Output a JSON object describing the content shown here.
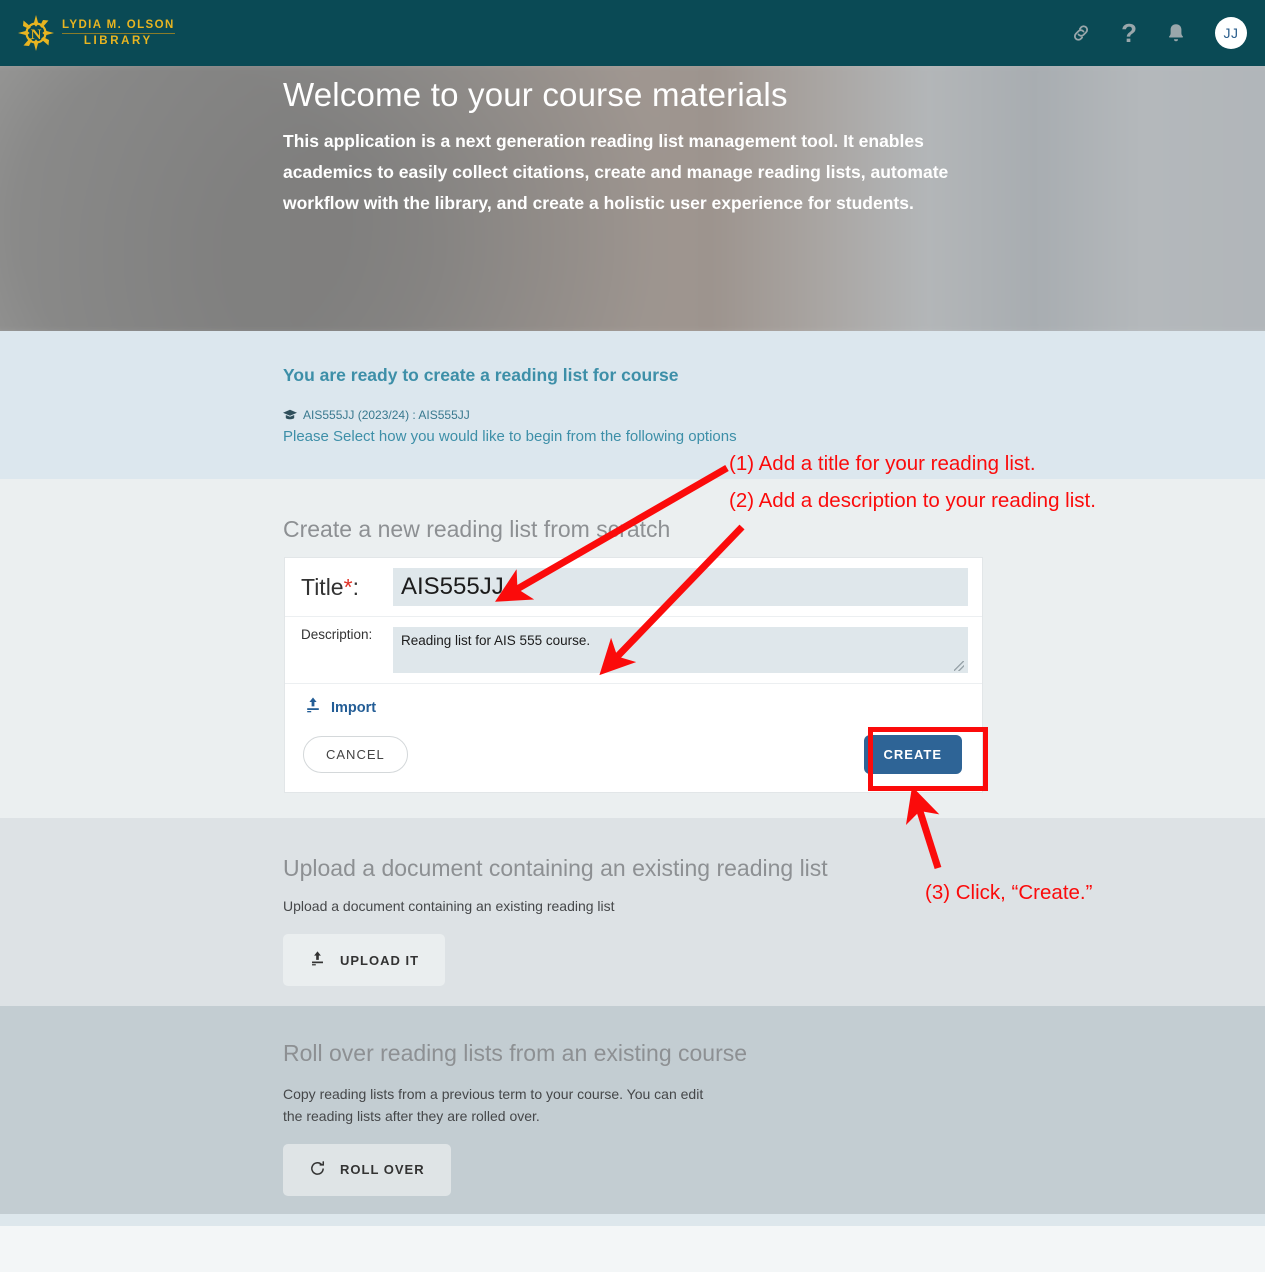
{
  "header": {
    "logo_line1": "LYDIA M. OLSON",
    "logo_line2": "LIBRARY",
    "logo_icon": "compass-rose-n-emblem",
    "icons": {
      "link": "link-icon",
      "help": "?",
      "help_icon": "question-mark-icon",
      "bell": "bell-icon"
    },
    "avatar_initials": "JJ",
    "bar_color": "#0a4a55",
    "logo_color": "#e8b521"
  },
  "hero": {
    "title": "Welcome to your course materials",
    "description": "This application is a next generation reading list management tool. It enables academics to easily collect citations, create and manage reading lists, automate workflow with the library, and create a holistic user experience for students."
  },
  "ready": {
    "title": "You are ready to create a reading list for course",
    "course_icon": "graduation-cap-icon",
    "course": "AIS555JJ (2023/24) : AIS555JJ",
    "note": "Please Select how you would like to begin from the following options",
    "accent_color": "#3d8fa8",
    "background": "#dce7ee"
  },
  "scratch": {
    "heading": "Create a new reading list from scratch",
    "title_label": "Title",
    "title_required_marker": "*",
    "title_label_suffix": ":",
    "title_value": "AIS555JJ",
    "title_placeholder": "",
    "description_label": "Description:",
    "description_value": "Reading list for AIS 555 course.",
    "description_placeholder": "",
    "import_label": "Import",
    "import_icon": "upload-icon",
    "cancel_label": "CANCEL",
    "create_label": "CREATE",
    "create_color": "#2e6496"
  },
  "upload": {
    "heading": "Upload a document containing an existing reading list",
    "description": "Upload a document containing an existing reading list",
    "button_label": "UPLOAD IT",
    "button_icon": "upload-icon"
  },
  "rollover": {
    "heading": "Roll over reading lists from an existing course",
    "description": "Copy reading lists from a previous term to your course. You can edit the reading lists after they are rolled over.",
    "button_label": "ROLL OVER",
    "button_icon": "refresh-icon"
  },
  "annotations": {
    "color": "#fb0b0b",
    "step1": "(1) Add a title for your reading list.",
    "step2": "(2) Add a description to your reading list.",
    "step3": "(3) Click, “Create.”"
  }
}
